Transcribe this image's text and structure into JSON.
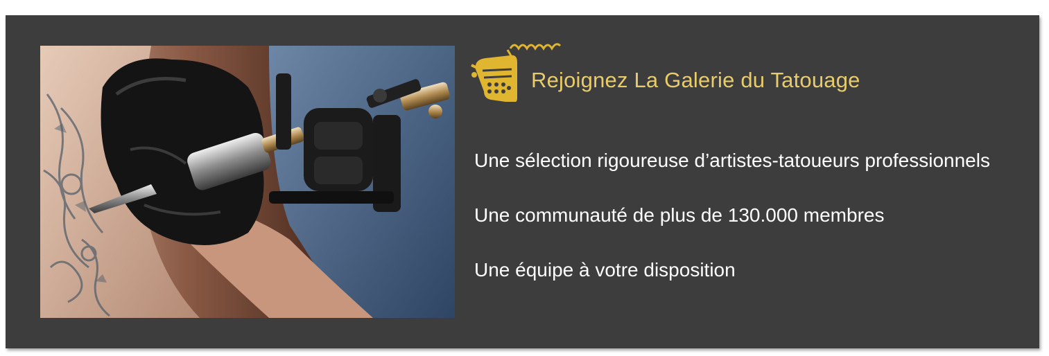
{
  "banner": {
    "title": "Rejoignez La Galerie du Tatouage",
    "features": [
      "Une sélection rigoureuse d’artistes-tatoueurs professionnels",
      "Une communauté de plus de 130.000 membres",
      "Une équipe à votre disposition"
    ],
    "photo_icon": "tattoo-machine-photo",
    "logo_icon": "tattoo-machine-icon"
  },
  "colors": {
    "background": "#3d3d3d",
    "title": "#e8cc6b",
    "text": "#ffffff",
    "logo": "#e0b530"
  }
}
